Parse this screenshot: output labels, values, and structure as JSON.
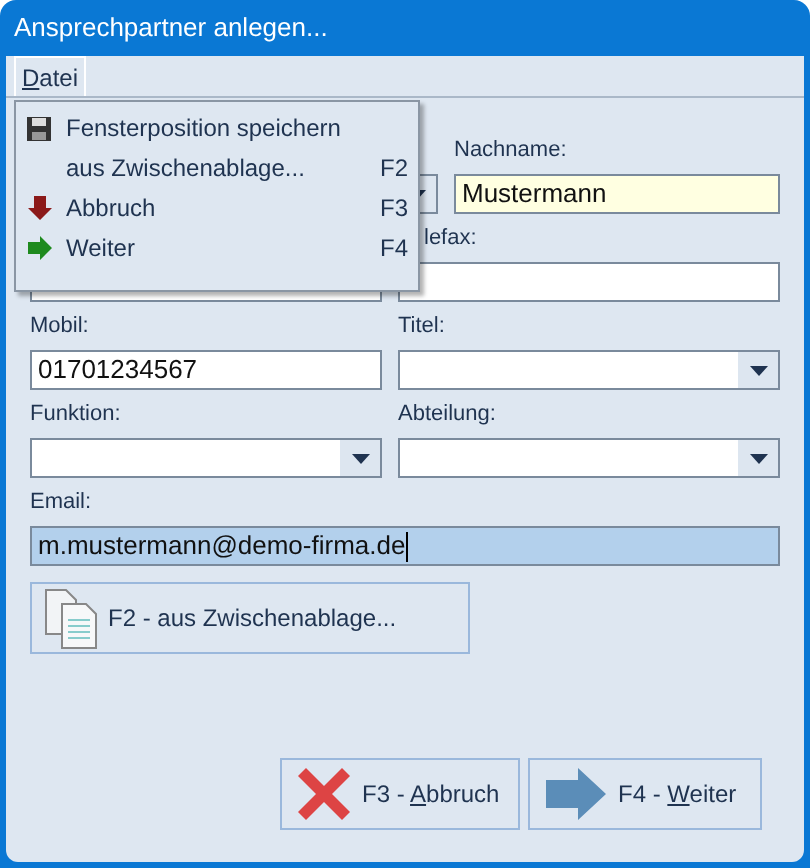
{
  "window": {
    "title": "Ansprechpartner anlegen..."
  },
  "menubar": [
    {
      "mnemonic": "D",
      "after": "atei",
      "selected": true
    }
  ],
  "menu": [
    {
      "kind": "save",
      "label": "Fensterposition speichern"
    },
    {
      "kind": "plain",
      "label": "aus Zwischenablage...",
      "shortcut": "F2"
    },
    {
      "kind": "cancel",
      "label": "Abbruch",
      "shortcut": "F3"
    },
    {
      "kind": "next",
      "label": "Weiter",
      "shortcut": "F4"
    }
  ],
  "form": [
    [
      {
        "kind": "combo"
      },
      {
        "kind": "text",
        "label": "Nachname:",
        "value": "Mustermann",
        "required": true,
        "focused": false
      }
    ],
    [
      {
        "kind": "text"
      },
      {
        "kind": "text",
        "label": "lefax:",
        "required": false,
        "focused": false
      }
    ],
    [
      {
        "kind": "text",
        "label": "Mobil:",
        "value": "01701234567",
        "required": false,
        "focused": false
      },
      {
        "kind": "combo",
        "label": "Titel:",
        "required": false,
        "focused": false
      }
    ],
    [
      {
        "kind": "combo",
        "label": "Funktion:",
        "required": false,
        "focused": false
      },
      {
        "kind": "combo",
        "label": "Abteilung:",
        "required": false,
        "focused": false
      }
    ],
    [
      {
        "kind": "text",
        "label": "Email:",
        "value": "m.mustermann@demo-firma.de",
        "required": false,
        "focused": true
      }
    ]
  ],
  "clipboard_button": {
    "label": "F2 - aus Zwischenablage..."
  },
  "buttons": [
    {
      "kind": "cancel",
      "before": "F3 - ",
      "mnemonic": "A",
      "after": "bbruch"
    },
    {
      "kind": "next",
      "before": "F4 - ",
      "mnemonic": "W",
      "after": "eiter"
    }
  ]
}
